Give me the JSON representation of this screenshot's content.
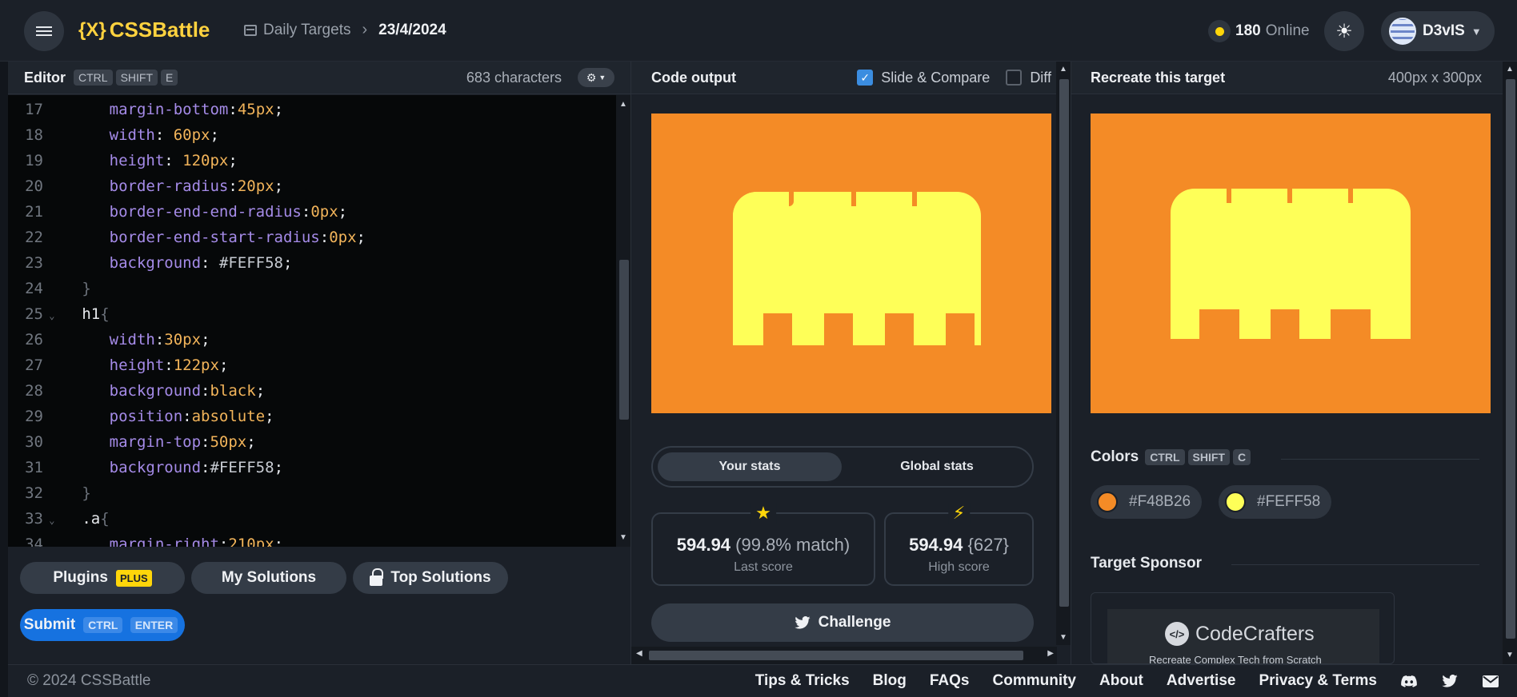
{
  "header": {
    "logo_mark": "{X}",
    "logo_text": "CSSBattle",
    "breadcrumb_section": "Daily Targets",
    "breadcrumb_current": "23/4/2024",
    "online_count": "180",
    "online_label": "Online",
    "username": "D3vIS"
  },
  "editor": {
    "title": "Editor",
    "shortcut": [
      "CTRL",
      "SHIFT",
      "E"
    ],
    "char_count": "683 characters",
    "lines": [
      {
        "n": "17",
        "tokens": [
          [
            "prop",
            "margin-bottom"
          ],
          [
            "plain",
            ":"
          ],
          [
            "val",
            "45px"
          ],
          [
            "plain",
            ";"
          ]
        ],
        "indent": 2
      },
      {
        "n": "18",
        "tokens": [
          [
            "prop",
            "width"
          ],
          [
            "plain",
            ": "
          ],
          [
            "val",
            "60px"
          ],
          [
            "plain",
            ";"
          ]
        ],
        "indent": 2
      },
      {
        "n": "19",
        "tokens": [
          [
            "prop",
            "height"
          ],
          [
            "plain",
            ": "
          ],
          [
            "val",
            "120px"
          ],
          [
            "plain",
            ";"
          ]
        ],
        "indent": 2
      },
      {
        "n": "20",
        "tokens": [
          [
            "prop",
            "border-radius"
          ],
          [
            "plain",
            ":"
          ],
          [
            "val",
            "20px"
          ],
          [
            "plain",
            ";"
          ]
        ],
        "indent": 2
      },
      {
        "n": "21",
        "tokens": [
          [
            "prop",
            "border-end-end-radius"
          ],
          [
            "plain",
            ":"
          ],
          [
            "val",
            "0px"
          ],
          [
            "plain",
            ";"
          ]
        ],
        "indent": 2
      },
      {
        "n": "22",
        "tokens": [
          [
            "prop",
            "border-end-start-radius"
          ],
          [
            "plain",
            ":"
          ],
          [
            "val",
            "0px"
          ],
          [
            "plain",
            ";"
          ]
        ],
        "indent": 2
      },
      {
        "n": "23",
        "tokens": [
          [
            "prop",
            "background"
          ],
          [
            "plain",
            ": "
          ],
          [
            "hex",
            "#FEFF58"
          ],
          [
            "plain",
            ";"
          ]
        ],
        "indent": 2
      },
      {
        "n": "24",
        "tokens": [
          [
            "brace",
            "}"
          ]
        ],
        "indent": 1
      },
      {
        "n": "25",
        "tokens": [
          [
            "plain",
            "h1"
          ],
          [
            "brace",
            "{"
          ]
        ],
        "indent": 1,
        "fold": true
      },
      {
        "n": "26",
        "tokens": [
          [
            "prop",
            "width"
          ],
          [
            "plain",
            ":"
          ],
          [
            "val",
            "30px"
          ],
          [
            "plain",
            ";"
          ]
        ],
        "indent": 2
      },
      {
        "n": "27",
        "tokens": [
          [
            "prop",
            "height"
          ],
          [
            "plain",
            ":"
          ],
          [
            "val",
            "122px"
          ],
          [
            "plain",
            ";"
          ]
        ],
        "indent": 2
      },
      {
        "n": "28",
        "tokens": [
          [
            "prop",
            "background"
          ],
          [
            "plain",
            ":"
          ],
          [
            "val",
            "black"
          ],
          [
            "plain",
            ";"
          ]
        ],
        "indent": 2
      },
      {
        "n": "29",
        "tokens": [
          [
            "prop",
            "position"
          ],
          [
            "plain",
            ":"
          ],
          [
            "val",
            "absolute"
          ],
          [
            "plain",
            ";"
          ]
        ],
        "indent": 2
      },
      {
        "n": "30",
        "tokens": [
          [
            "prop",
            "margin-top"
          ],
          [
            "plain",
            ":"
          ],
          [
            "val",
            "50px"
          ],
          [
            "plain",
            ";"
          ]
        ],
        "indent": 2
      },
      {
        "n": "31",
        "tokens": [
          [
            "prop",
            "background"
          ],
          [
            "plain",
            ":"
          ],
          [
            "hex",
            "#FEFF58"
          ],
          [
            "plain",
            ";"
          ]
        ],
        "indent": 2
      },
      {
        "n": "32",
        "tokens": [
          [
            "brace",
            "}"
          ]
        ],
        "indent": 1
      },
      {
        "n": "33",
        "tokens": [
          [
            "plain",
            ".a"
          ],
          [
            "brace",
            "{"
          ]
        ],
        "indent": 1,
        "fold": true
      },
      {
        "n": "34",
        "tokens": [
          [
            "prop",
            "margin-right"
          ],
          [
            "plain",
            ":"
          ],
          [
            "val",
            "210px"
          ],
          [
            "plain",
            ";"
          ]
        ],
        "indent": 2
      }
    ],
    "buttons": {
      "plugins": "Plugins",
      "plus_badge": "PLUS",
      "my_solutions": "My Solutions",
      "top_solutions": "Top Solutions",
      "submit": "Submit",
      "submit_kbd": [
        "CTRL",
        "ENTER"
      ]
    }
  },
  "output": {
    "title": "Code output",
    "slide_compare": "Slide & Compare",
    "slide_compare_checked": true,
    "diff": "Diff",
    "diff_checked": false,
    "stats_tabs": [
      "Your stats",
      "Global stats"
    ],
    "last_score": {
      "value": "594.94",
      "extra": "(99.8% match)",
      "label": "Last score"
    },
    "high_score": {
      "value": "594.94",
      "extra": "{627}",
      "label": "High score"
    },
    "challenge": "Challenge"
  },
  "target": {
    "title": "Recreate this target",
    "size": "400px x 300px",
    "colors_title": "Colors",
    "colors_kbd": [
      "CTRL",
      "SHIFT",
      "C"
    ],
    "colors": [
      {
        "hex": "#F48B26"
      },
      {
        "hex": "#FEFF58"
      }
    ],
    "sponsor_title": "Target Sponsor",
    "sponsor_name": "CodeCrafters",
    "sponsor_tagline": "Recreate Complex Tech from Scratch"
  },
  "canvas": {
    "background": "#F48B26",
    "shape_color": "#FEFF58"
  },
  "footer": {
    "copyright": "© 2024 CSSBattle",
    "links": [
      "Tips & Tricks",
      "Blog",
      "FAQs",
      "Community",
      "About",
      "Advertise",
      "Privacy & Terms"
    ]
  }
}
